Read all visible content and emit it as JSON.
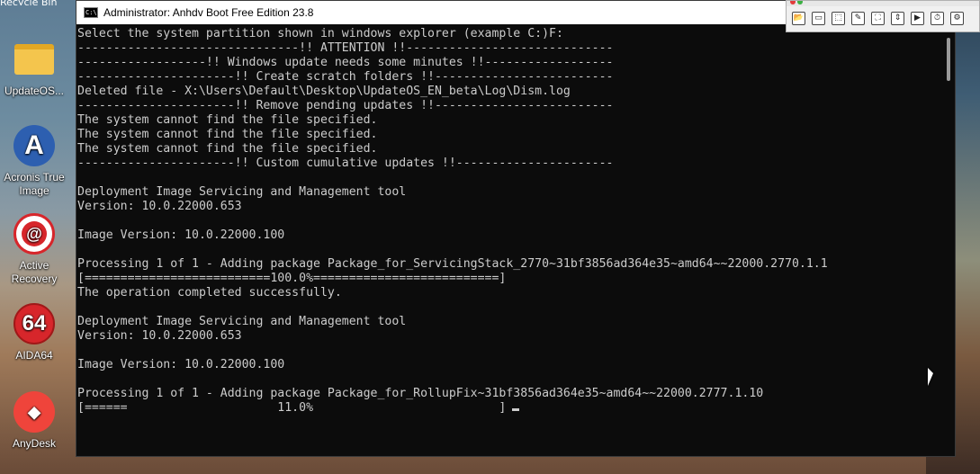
{
  "desktop": {
    "top_text": "Recycle Bin",
    "icons": [
      {
        "label": "UpdateOS...",
        "icon": "folder-icon"
      },
      {
        "label": "Acronis True Image",
        "icon": "acronis-icon",
        "color": "#2d5fb0"
      },
      {
        "label": "Active Recovery",
        "icon": "active-recovery-icon",
        "color": "#d7262b"
      },
      {
        "label": "AIDA64",
        "icon": "aida64-icon",
        "color": "#d7262b"
      },
      {
        "label": "AnyDesk",
        "icon": "anydesk-icon",
        "color": "#ef443b"
      }
    ]
  },
  "window": {
    "title": "Administrator:  Anhdv Boot Free Edition 23.8",
    "icon": "cmd-icon"
  },
  "console": {
    "lines": [
      "Select the system partition shown in windows explorer (example C:)F:",
      "-------------------------------!! ATTENTION !!-----------------------------",
      "------------------!! Windows update needs some minutes !!------------------",
      "----------------------!! Create scratch folders !!-------------------------",
      "Deleted file - X:\\Users\\Default\\Desktop\\UpdateOS_EN_beta\\Log\\Dism.log",
      "----------------------!! Remove pending updates !!-------------------------",
      "The system cannot find the file specified.",
      "The system cannot find the file specified.",
      "The system cannot find the file specified.",
      "----------------------!! Custom cumulative updates !!----------------------",
      "",
      "Deployment Image Servicing and Management tool",
      "Version: 10.0.22000.653",
      "",
      "Image Version: 10.0.22000.100",
      "",
      "Processing 1 of 1 - Adding package Package_for_ServicingStack_2770~31bf3856ad364e35~amd64~~22000.2770.1.1",
      "[==========================100.0%==========================]",
      "The operation completed successfully.",
      "",
      "Deployment Image Servicing and Management tool",
      "Version: 10.0.22000.653",
      "",
      "Image Version: 10.0.22000.100",
      "",
      "Processing 1 of 1 - Adding package Package_for_RollupFix~31bf3856ad364e35~amd64~~22000.2777.1.10",
      "[======                     11.0%                          ]"
    ],
    "progress_percent": 11.0
  },
  "capture_toolbar": {
    "icons": [
      "open-folder-icon",
      "window-capture-icon",
      "region-capture-icon",
      "freehand-capture-icon",
      "fullscreen-capture-icon",
      "scrolling-capture-icon",
      "video-capture-icon",
      "timer-icon",
      "settings-icon"
    ]
  }
}
